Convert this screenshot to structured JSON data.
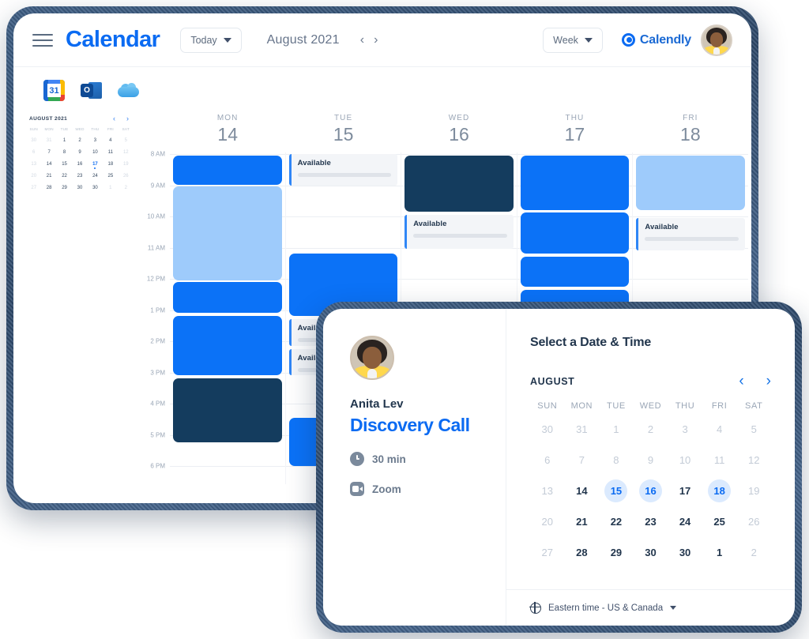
{
  "app": {
    "brand": "Calendar",
    "menu_icon": "hamburger-icon",
    "today_button": "Today",
    "month_label": "August 2021",
    "prev_arrow": "‹",
    "next_arrow": "›",
    "view_selector": "Week",
    "partner_logo_text": "Calendly"
  },
  "integrations": [
    {
      "name": "google-calendar",
      "badge": "31"
    },
    {
      "name": "outlook",
      "badge": "O"
    },
    {
      "name": "icloud",
      "badge": ""
    }
  ],
  "mini_calendar": {
    "title": "AUGUST 2021",
    "prev": "‹",
    "next": "›",
    "dow": [
      "SUN",
      "MON",
      "TUE",
      "WED",
      "THU",
      "FRI",
      "SAT"
    ],
    "weeks": [
      [
        {
          "n": "30",
          "s": "muted"
        },
        {
          "n": "31",
          "s": "muted"
        },
        {
          "n": "1",
          "s": "normal"
        },
        {
          "n": "2",
          "s": "normal"
        },
        {
          "n": "3",
          "s": "normal"
        },
        {
          "n": "4",
          "s": "normal"
        },
        {
          "n": "5",
          "s": "muted"
        }
      ],
      [
        {
          "n": "6",
          "s": "muted"
        },
        {
          "n": "7",
          "s": "normal"
        },
        {
          "n": "8",
          "s": "normal"
        },
        {
          "n": "9",
          "s": "normal"
        },
        {
          "n": "10",
          "s": "normal"
        },
        {
          "n": "11",
          "s": "normal"
        },
        {
          "n": "12",
          "s": "muted"
        }
      ],
      [
        {
          "n": "13",
          "s": "muted"
        },
        {
          "n": "14",
          "s": "normal"
        },
        {
          "n": "15",
          "s": "normal"
        },
        {
          "n": "16",
          "s": "normal"
        },
        {
          "n": "17",
          "s": "today"
        },
        {
          "n": "18",
          "s": "normal"
        },
        {
          "n": "19",
          "s": "muted"
        }
      ],
      [
        {
          "n": "20",
          "s": "muted"
        },
        {
          "n": "21",
          "s": "normal"
        },
        {
          "n": "22",
          "s": "normal"
        },
        {
          "n": "23",
          "s": "normal"
        },
        {
          "n": "24",
          "s": "normal"
        },
        {
          "n": "25",
          "s": "normal"
        },
        {
          "n": "26",
          "s": "muted"
        }
      ],
      [
        {
          "n": "27",
          "s": "muted"
        },
        {
          "n": "28",
          "s": "normal"
        },
        {
          "n": "29",
          "s": "normal"
        },
        {
          "n": "30",
          "s": "normal"
        },
        {
          "n": "30",
          "s": "normal"
        },
        {
          "n": "1",
          "s": "muted"
        },
        {
          "n": "2",
          "s": "muted"
        }
      ]
    ]
  },
  "week_view": {
    "days": [
      {
        "dow": "MON",
        "num": "14"
      },
      {
        "dow": "TUE",
        "num": "15"
      },
      {
        "dow": "WED",
        "num": "16"
      },
      {
        "dow": "THU",
        "num": "17"
      },
      {
        "dow": "FRI",
        "num": "18"
      }
    ],
    "hours": [
      "8 AM",
      "9 AM",
      "10 AM",
      "11 AM",
      "12 PM",
      "1 PM",
      "2 PM",
      "3 PM",
      "4 PM",
      "5 PM",
      "6 PM"
    ],
    "available_label": "Available",
    "events": [
      {
        "day": 0,
        "start": 0.05,
        "end": 1.0,
        "kind": "busy"
      },
      {
        "day": 0,
        "start": 1.05,
        "end": 4.05,
        "kind": "tentative"
      },
      {
        "day": 0,
        "start": 4.1,
        "end": 5.1,
        "kind": "busy"
      },
      {
        "day": 0,
        "start": 5.2,
        "end": 7.1,
        "kind": "busy"
      },
      {
        "day": 0,
        "start": 7.2,
        "end": 9.25,
        "kind": "dark"
      },
      {
        "day": 1,
        "start": 0.0,
        "end": 1.0,
        "kind": "avail"
      },
      {
        "day": 1,
        "start": 3.2,
        "end": 5.2,
        "kind": "busy"
      },
      {
        "day": 1,
        "start": 5.3,
        "end": 6.15,
        "kind": "avail"
      },
      {
        "day": 1,
        "start": 6.25,
        "end": 7.1,
        "kind": "avail"
      },
      {
        "day": 1,
        "start": 8.45,
        "end": 10.0,
        "kind": "busy"
      },
      {
        "day": 2,
        "start": 0.05,
        "end": 1.85,
        "kind": "dark"
      },
      {
        "day": 2,
        "start": 1.95,
        "end": 3.05,
        "kind": "avail"
      },
      {
        "day": 3,
        "start": 0.05,
        "end": 1.8,
        "kind": "busy"
      },
      {
        "day": 3,
        "start": 1.88,
        "end": 3.2,
        "kind": "busy"
      },
      {
        "day": 3,
        "start": 3.28,
        "end": 4.25,
        "kind": "busy"
      },
      {
        "day": 3,
        "start": 4.35,
        "end": 5.6,
        "kind": "busy"
      },
      {
        "day": 4,
        "start": 0.05,
        "end": 1.8,
        "kind": "tentative"
      },
      {
        "day": 4,
        "start": 2.05,
        "end": 3.1,
        "kind": "avail"
      }
    ]
  },
  "booking": {
    "host_name": "Anita Lev",
    "event_title": "Discovery Call",
    "duration": "30 min",
    "location": "Zoom",
    "select_title": "Select a Date & Time",
    "month": "AUGUST",
    "prev": "‹",
    "next": "›",
    "dow": [
      "SUN",
      "MON",
      "TUE",
      "WED",
      "THU",
      "FRI",
      "SAT"
    ],
    "weeks": [
      [
        {
          "n": "30",
          "s": "muted"
        },
        {
          "n": "31",
          "s": "muted"
        },
        {
          "n": "1",
          "s": "muted"
        },
        {
          "n": "2",
          "s": "muted"
        },
        {
          "n": "3",
          "s": "muted"
        },
        {
          "n": "4",
          "s": "muted"
        },
        {
          "n": "5",
          "s": "muted"
        }
      ],
      [
        {
          "n": "6",
          "s": "muted"
        },
        {
          "n": "7",
          "s": "muted"
        },
        {
          "n": "8",
          "s": "muted"
        },
        {
          "n": "9",
          "s": "muted"
        },
        {
          "n": "10",
          "s": "muted"
        },
        {
          "n": "11",
          "s": "muted"
        },
        {
          "n": "12",
          "s": "muted"
        }
      ],
      [
        {
          "n": "13",
          "s": "muted"
        },
        {
          "n": "14",
          "s": "normal"
        },
        {
          "n": "15",
          "s": "avail"
        },
        {
          "n": "16",
          "s": "avail"
        },
        {
          "n": "17",
          "s": "normal"
        },
        {
          "n": "18",
          "s": "avail"
        },
        {
          "n": "19",
          "s": "muted"
        }
      ],
      [
        {
          "n": "20",
          "s": "muted"
        },
        {
          "n": "21",
          "s": "normal"
        },
        {
          "n": "22",
          "s": "normal"
        },
        {
          "n": "23",
          "s": "normal"
        },
        {
          "n": "24",
          "s": "normal"
        },
        {
          "n": "25",
          "s": "normal"
        },
        {
          "n": "26",
          "s": "muted"
        }
      ],
      [
        {
          "n": "27",
          "s": "muted"
        },
        {
          "n": "28",
          "s": "normal"
        },
        {
          "n": "29",
          "s": "normal"
        },
        {
          "n": "30",
          "s": "normal"
        },
        {
          "n": "30",
          "s": "normal"
        },
        {
          "n": "1",
          "s": "normal"
        },
        {
          "n": "2",
          "s": "muted"
        }
      ]
    ],
    "timezone": "Eastern time - US & Canada",
    "timezone_caret": "▾"
  },
  "colors": {
    "brand_blue": "#0b6bf2",
    "busy": "#0b72f7",
    "tentative": "#9ecbfb",
    "dark": "#143c5e",
    "frame": "#2f4a6b",
    "available_bg": "#f3f5f8"
  }
}
